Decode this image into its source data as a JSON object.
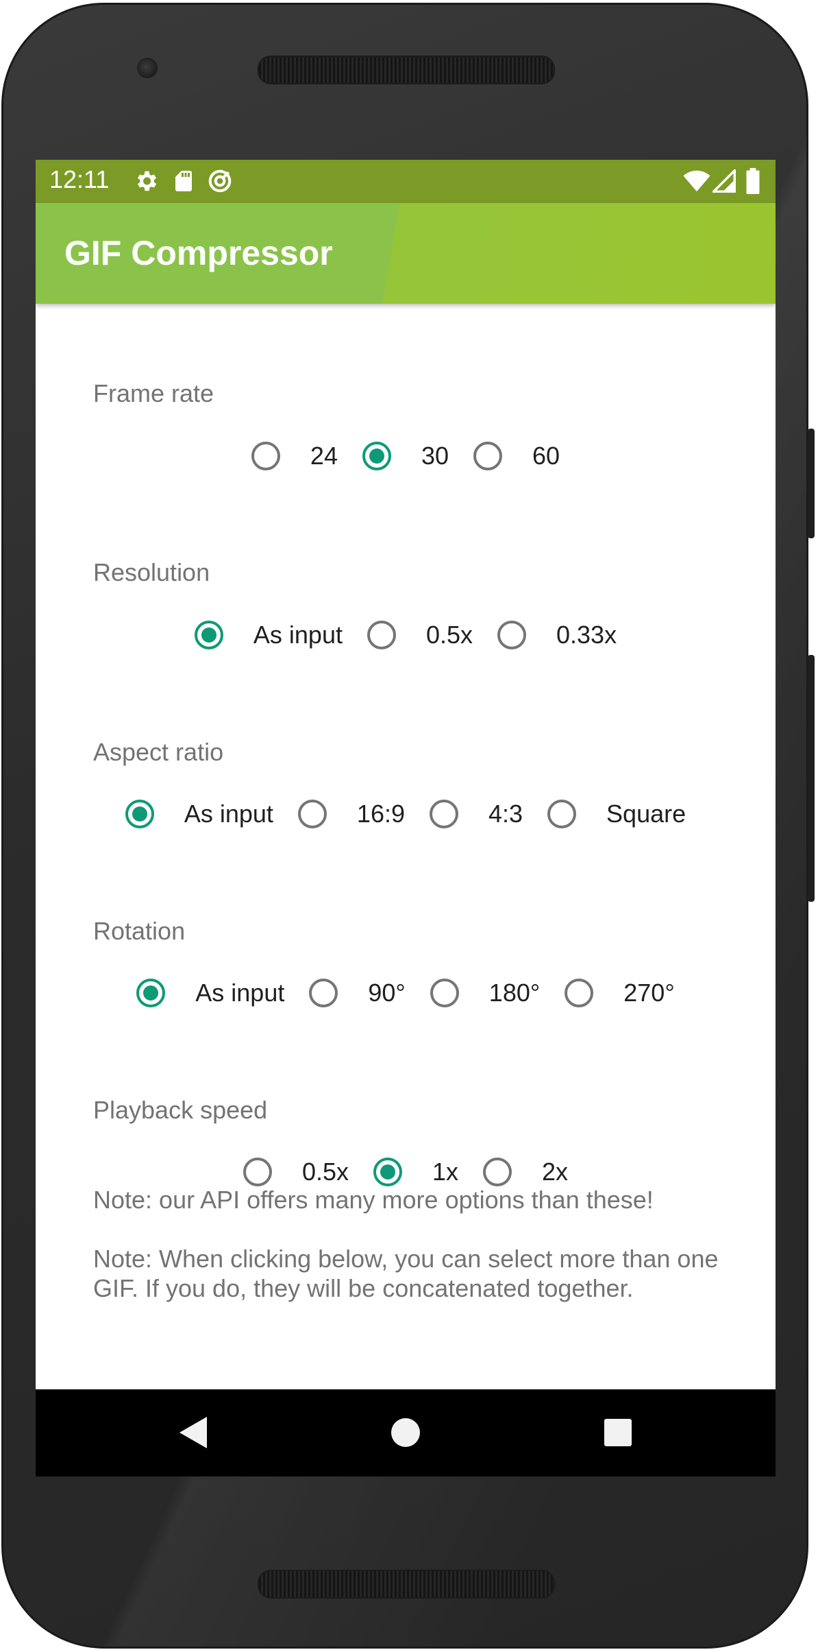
{
  "status_bar": {
    "time": "12:11",
    "left_icons": [
      "gear-icon",
      "sd-card-icon",
      "sync-icon"
    ],
    "right_icons": [
      "wifi-icon",
      "signal-icon",
      "battery-icon"
    ]
  },
  "app_bar": {
    "title": "GIF Compressor"
  },
  "settings": {
    "frame_rate": {
      "label": "Frame rate",
      "options": [
        "24",
        "30",
        "60"
      ],
      "selected": "30"
    },
    "resolution": {
      "label": "Resolution",
      "options": [
        "As input",
        "0.5x",
        "0.33x"
      ],
      "selected": "As input"
    },
    "aspect_ratio": {
      "label": "Aspect ratio",
      "options": [
        "As input",
        "16:9",
        "4:3",
        "Square"
      ],
      "selected": "As input"
    },
    "rotation": {
      "label": "Rotation",
      "options": [
        "As input",
        "90°",
        "180°",
        "270°"
      ],
      "selected": "As input"
    },
    "playback_speed": {
      "label": "Playback speed",
      "options": [
        "0.5x",
        "1x",
        "2x"
      ],
      "selected": "1x"
    }
  },
  "notes": {
    "note1": "Note: our API offers many more options than these!",
    "note2": "Note: When clicking below, you can select more than one GIF. If you do, they will be concatenated together."
  },
  "nav_bar": {
    "buttons": [
      "back-icon",
      "home-icon",
      "recents-icon"
    ]
  },
  "colors": {
    "accent": "#0e9a76",
    "app_bar": "#8bc34a",
    "status_bar": "#7b9b26"
  }
}
